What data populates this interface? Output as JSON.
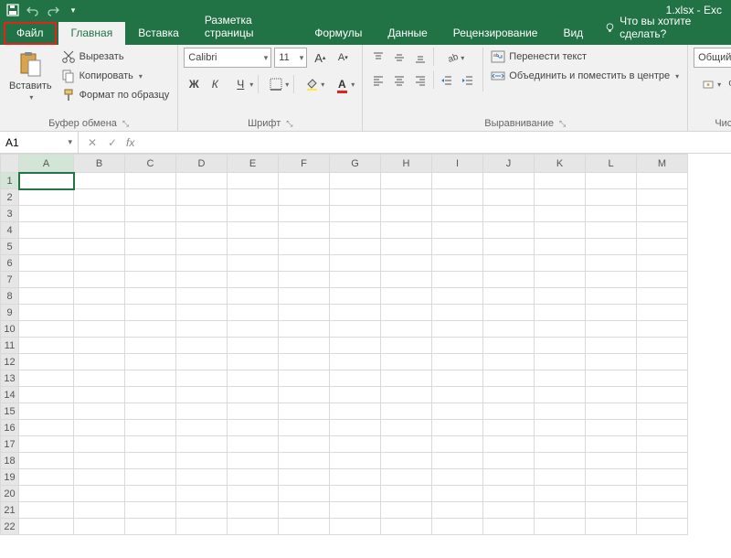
{
  "title": "1.xlsx - Exc",
  "tabs": {
    "file": "Файл",
    "home": "Главная",
    "insert": "Вставка",
    "layout": "Разметка страницы",
    "formulas": "Формулы",
    "data": "Данные",
    "review": "Рецензирование",
    "view": "Вид",
    "tellme": "Что вы хотите сделать?"
  },
  "clipboard": {
    "paste": "Вставить",
    "cut": "Вырезать",
    "copy": "Копировать",
    "painter": "Формат по образцу",
    "group": "Буфер обмена"
  },
  "font": {
    "name": "Calibri",
    "size": "11",
    "group": "Шрифт",
    "bold": "Ж",
    "italic": "К",
    "underline": "Ч"
  },
  "alignment": {
    "wrap": "Перенести текст",
    "merge": "Объединить и поместить в центре",
    "group": "Выравнивание"
  },
  "number": {
    "format": "Общий",
    "group": "Число"
  },
  "namebox": "A1",
  "columns": [
    "A",
    "B",
    "C",
    "D",
    "E",
    "F",
    "G",
    "H",
    "I",
    "J",
    "K",
    "L",
    "M"
  ],
  "rows": [
    1,
    2,
    3,
    4,
    5,
    6,
    7,
    8,
    9,
    10,
    11,
    12,
    13,
    14,
    15,
    16,
    17,
    18,
    19,
    20,
    21,
    22
  ]
}
